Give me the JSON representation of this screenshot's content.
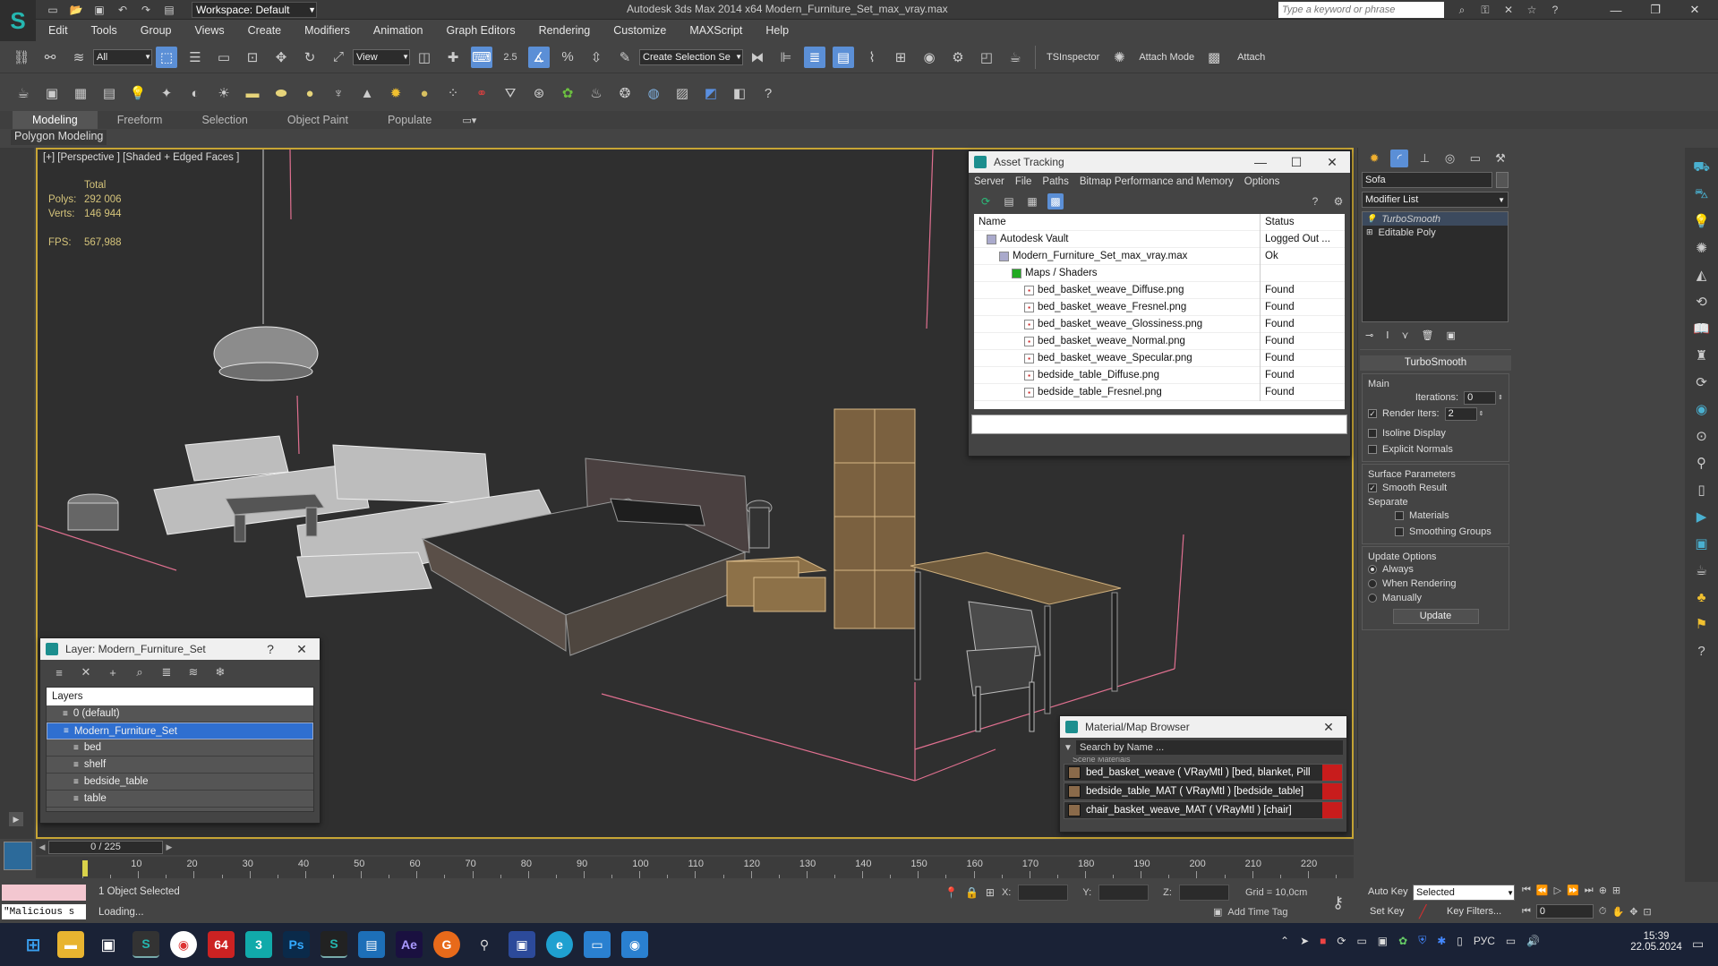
{
  "titlebar": {
    "workspace": "Workspace: Default",
    "window_title": "Autodesk 3ds Max  2014 x64      Modern_Furniture_Set_max_vray.max",
    "search_placeholder": "Type a keyword or phrase"
  },
  "menu": [
    "Edit",
    "Tools",
    "Group",
    "Views",
    "Create",
    "Modifiers",
    "Animation",
    "Graph Editors",
    "Rendering",
    "Customize",
    "MAXScript",
    "Help"
  ],
  "toolbar": {
    "filter_select": "All",
    "view_select": "View",
    "snap_value": "2.5",
    "selection_set": "Create Selection Se",
    "tsinspector": "TSInspector",
    "attach_mode": "Attach Mode",
    "attach": "Attach"
  },
  "ribbon": {
    "tabs": [
      "Modeling",
      "Freeform",
      "Selection",
      "Object Paint",
      "Populate"
    ],
    "active_tab": "Modeling",
    "panel_label": "Polygon Modeling"
  },
  "viewport": {
    "label": "[+] [Perspective ] [Shaded + Edged Faces ]",
    "stats": {
      "total_label": "Total",
      "polys_label": "Polys:",
      "polys": "292 006",
      "verts_label": "Verts:",
      "verts": "146 944",
      "fps_label": "FPS:",
      "fps": "567,988"
    }
  },
  "asset_tracking": {
    "title": "Asset Tracking",
    "menu": [
      "Server",
      "File",
      "Paths",
      "Bitmap Performance and Memory",
      "Options"
    ],
    "columns": [
      "Name",
      "Status"
    ],
    "rows": [
      {
        "name": "Autodesk Vault",
        "status": "Logged Out ...",
        "indent": 1
      },
      {
        "name": "Modern_Furniture_Set_max_vray.max",
        "status": "Ok",
        "indent": 2
      },
      {
        "name": "Maps / Shaders",
        "status": "",
        "indent": 3
      },
      {
        "name": "bed_basket_weave_Diffuse.png",
        "status": "Found",
        "indent": 4
      },
      {
        "name": "bed_basket_weave_Fresnel.png",
        "status": "Found",
        "indent": 4
      },
      {
        "name": "bed_basket_weave_Glossiness.png",
        "status": "Found",
        "indent": 4
      },
      {
        "name": "bed_basket_weave_Normal.png",
        "status": "Found",
        "indent": 4
      },
      {
        "name": "bed_basket_weave_Specular.png",
        "status": "Found",
        "indent": 4
      },
      {
        "name": "bedside_table_Diffuse.png",
        "status": "Found",
        "indent": 4
      },
      {
        "name": "bedside_table_Fresnel.png",
        "status": "Found",
        "indent": 4
      }
    ]
  },
  "layer_window": {
    "title": "Layer: Modern_Furniture_Set",
    "help": "?",
    "header": "Layers",
    "rows": [
      {
        "name": "0 (default)",
        "indent": 1,
        "selected": false
      },
      {
        "name": "Modern_Furniture_Set",
        "indent": 1,
        "selected": true
      },
      {
        "name": "bed",
        "indent": 2,
        "selected": false
      },
      {
        "name": "shelf",
        "indent": 2,
        "selected": false
      },
      {
        "name": "bedside_table",
        "indent": 2,
        "selected": false
      },
      {
        "name": "table",
        "indent": 2,
        "selected": false
      }
    ]
  },
  "material_browser": {
    "title": "Material/Map Browser",
    "search_placeholder": "Search by Name ...",
    "section": "Scene Materials",
    "rows": [
      "bed_basket_weave ( VRayMtl ) [bed, blanket, Pill...",
      "bedside_table_MAT ( VRayMtl ) [bedside_table]",
      "chair_basket_weave_MAT ( VRayMtl ) [chair]"
    ]
  },
  "command_panel": {
    "object_name": "Sofa",
    "modifier_list": "Modifier List",
    "stack": [
      "TurboSmooth",
      "Editable Poly"
    ],
    "rollout": "TurboSmooth",
    "main_label": "Main",
    "iterations_label": "Iterations:",
    "iterations": "0",
    "render_iters_label": "Render Iters:",
    "render_iters": "2",
    "isoline_label": "Isoline Display",
    "explicit_normals_label": "Explicit Normals",
    "surface_params_label": "Surface Parameters",
    "smooth_result_label": "Smooth Result",
    "separate_label": "Separate",
    "materials_label": "Materials",
    "smoothing_groups_label": "Smoothing Groups",
    "update_options_label": "Update Options",
    "always_label": "Always",
    "when_rendering_label": "When Rendering",
    "manually_label": "Manually",
    "update_button": "Update"
  },
  "timeline": {
    "frame": "0 / 225",
    "ticks": [
      "10",
      "20",
      "30",
      "40",
      "50",
      "60",
      "70",
      "80",
      "90",
      "100",
      "110",
      "120",
      "130",
      "140",
      "150",
      "160",
      "170",
      "180",
      "190",
      "200",
      "210",
      "220"
    ]
  },
  "status": {
    "selection": "1 Object Selected",
    "loading": "Loading...",
    "maxscript": "\"Malicious s",
    "x_label": "X:",
    "y_label": "Y:",
    "z_label": "Z:",
    "grid": "Grid = 10,0cm",
    "add_time_tag": "Add Time Tag",
    "auto_key": "Auto Key",
    "set_key": "Set Key",
    "selected_select": "Selected",
    "key_filters": "Key Filters...",
    "frame_value": "0"
  },
  "taskbar": {
    "lang": "РУС",
    "time": "15:39",
    "date": "22.05.2024",
    "badge": "64"
  }
}
